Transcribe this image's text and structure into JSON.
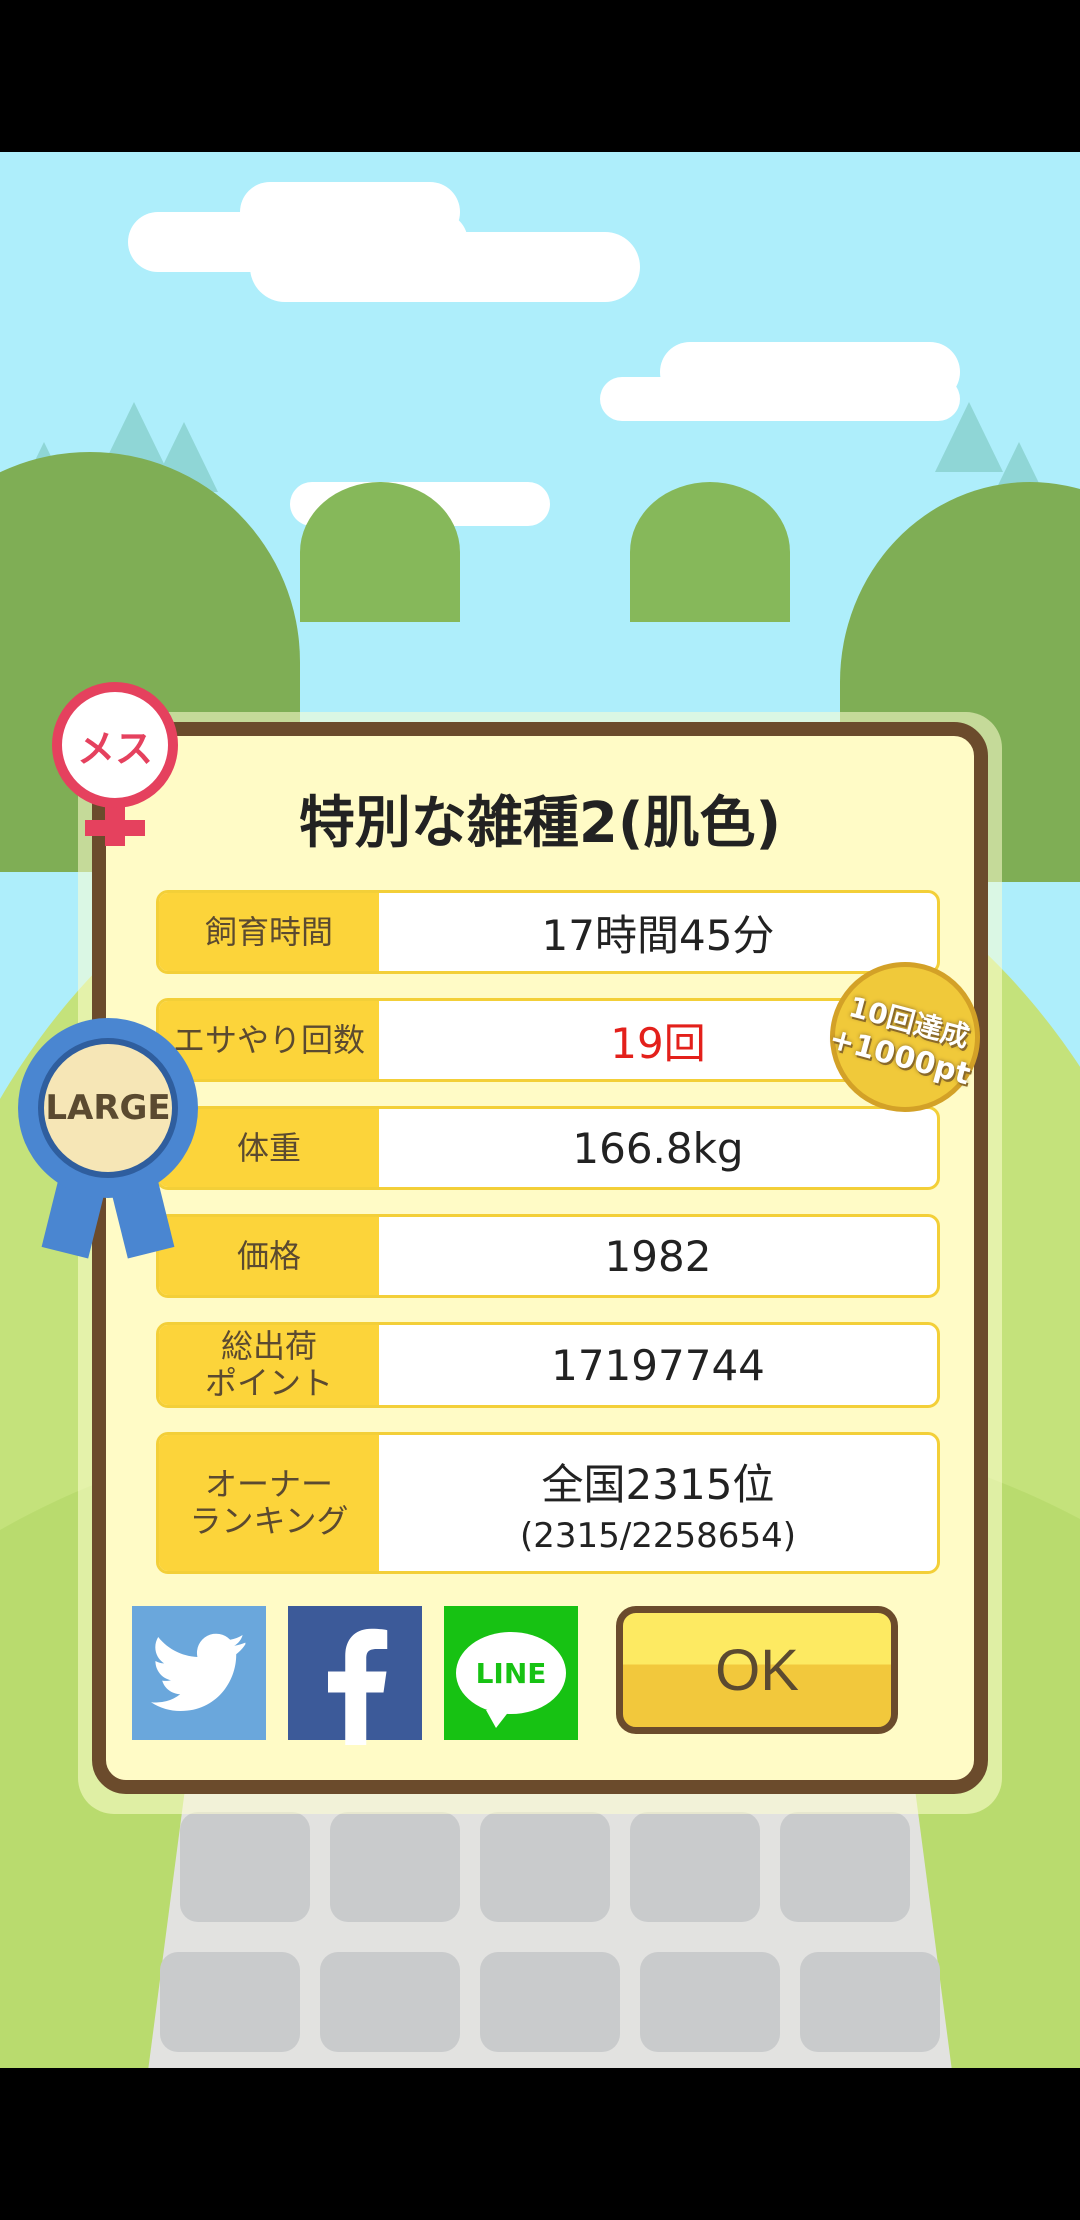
{
  "dialog": {
    "title": "特別な雑種2(肌色)",
    "rows": [
      {
        "label": "飼育時間",
        "value": "17時間45分"
      },
      {
        "label": "エサやり回数",
        "value": "19回",
        "color": "#e3201b"
      },
      {
        "label": "体重",
        "value": "166.8kg"
      },
      {
        "label": "価格",
        "value": "1982"
      },
      {
        "label": "総出荷\nポイント",
        "value": "17197744"
      },
      {
        "label": "オーナー\nランキング",
        "value": "全国2315位",
        "sub": "(2315/2258654)"
      }
    ],
    "ok_label": "OK",
    "social": {
      "twitter_icon": "twitter-bird-icon",
      "facebook_icon": "facebook-f-icon",
      "line_text": "LINE"
    }
  },
  "badges": {
    "gender": "メス",
    "size": "LARGE",
    "bonus_line1": "10回達成",
    "bonus_line2": "+1000pt"
  },
  "colors": {
    "frame": "#6b4b2c",
    "label_bg": "#fcd43a",
    "twitter": "#6aa7dc",
    "facebook": "#3c5a99",
    "line": "#17c213",
    "female": "#e5415e"
  }
}
